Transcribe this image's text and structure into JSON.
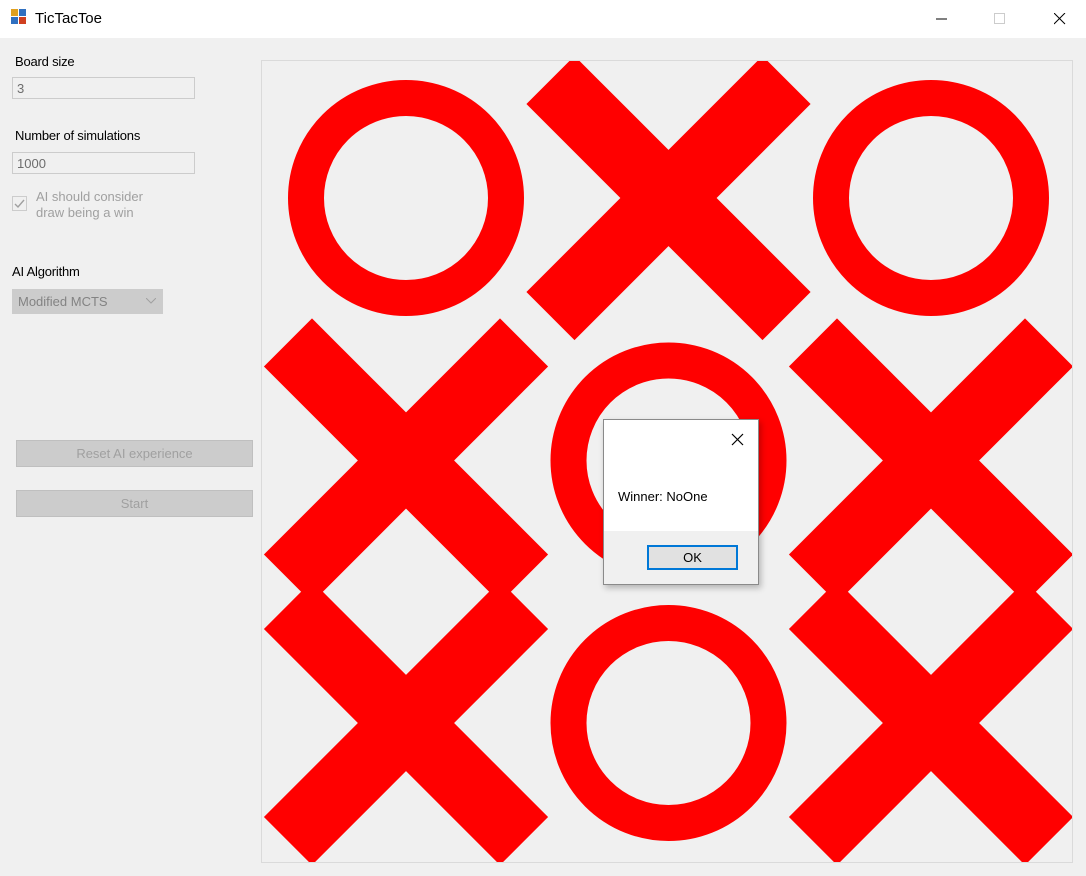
{
  "window": {
    "title": "TicTacToe",
    "app_icon": "tictactoe-app-icon"
  },
  "settings": {
    "board_size_label": "Board size",
    "board_size_value": "3",
    "simulations_label": "Number of simulations",
    "simulations_value": "1000",
    "draw_checkbox_line1": "AI should consider",
    "draw_checkbox_line2": "draw being a win",
    "draw_checkbox_checked": true,
    "algorithm_label": "AI Algorithm",
    "algorithm_value": "Modified MCTS"
  },
  "buttons": {
    "reset_label": "Reset AI experience",
    "start_label": "Start"
  },
  "board": {
    "size": 3,
    "cells": [
      "O",
      "X",
      "O",
      "X",
      "O",
      "X",
      "X",
      "O",
      "X"
    ],
    "mark_color": "#ff0000"
  },
  "dialog": {
    "message": "Winner: NoOne",
    "ok_label": "OK"
  }
}
